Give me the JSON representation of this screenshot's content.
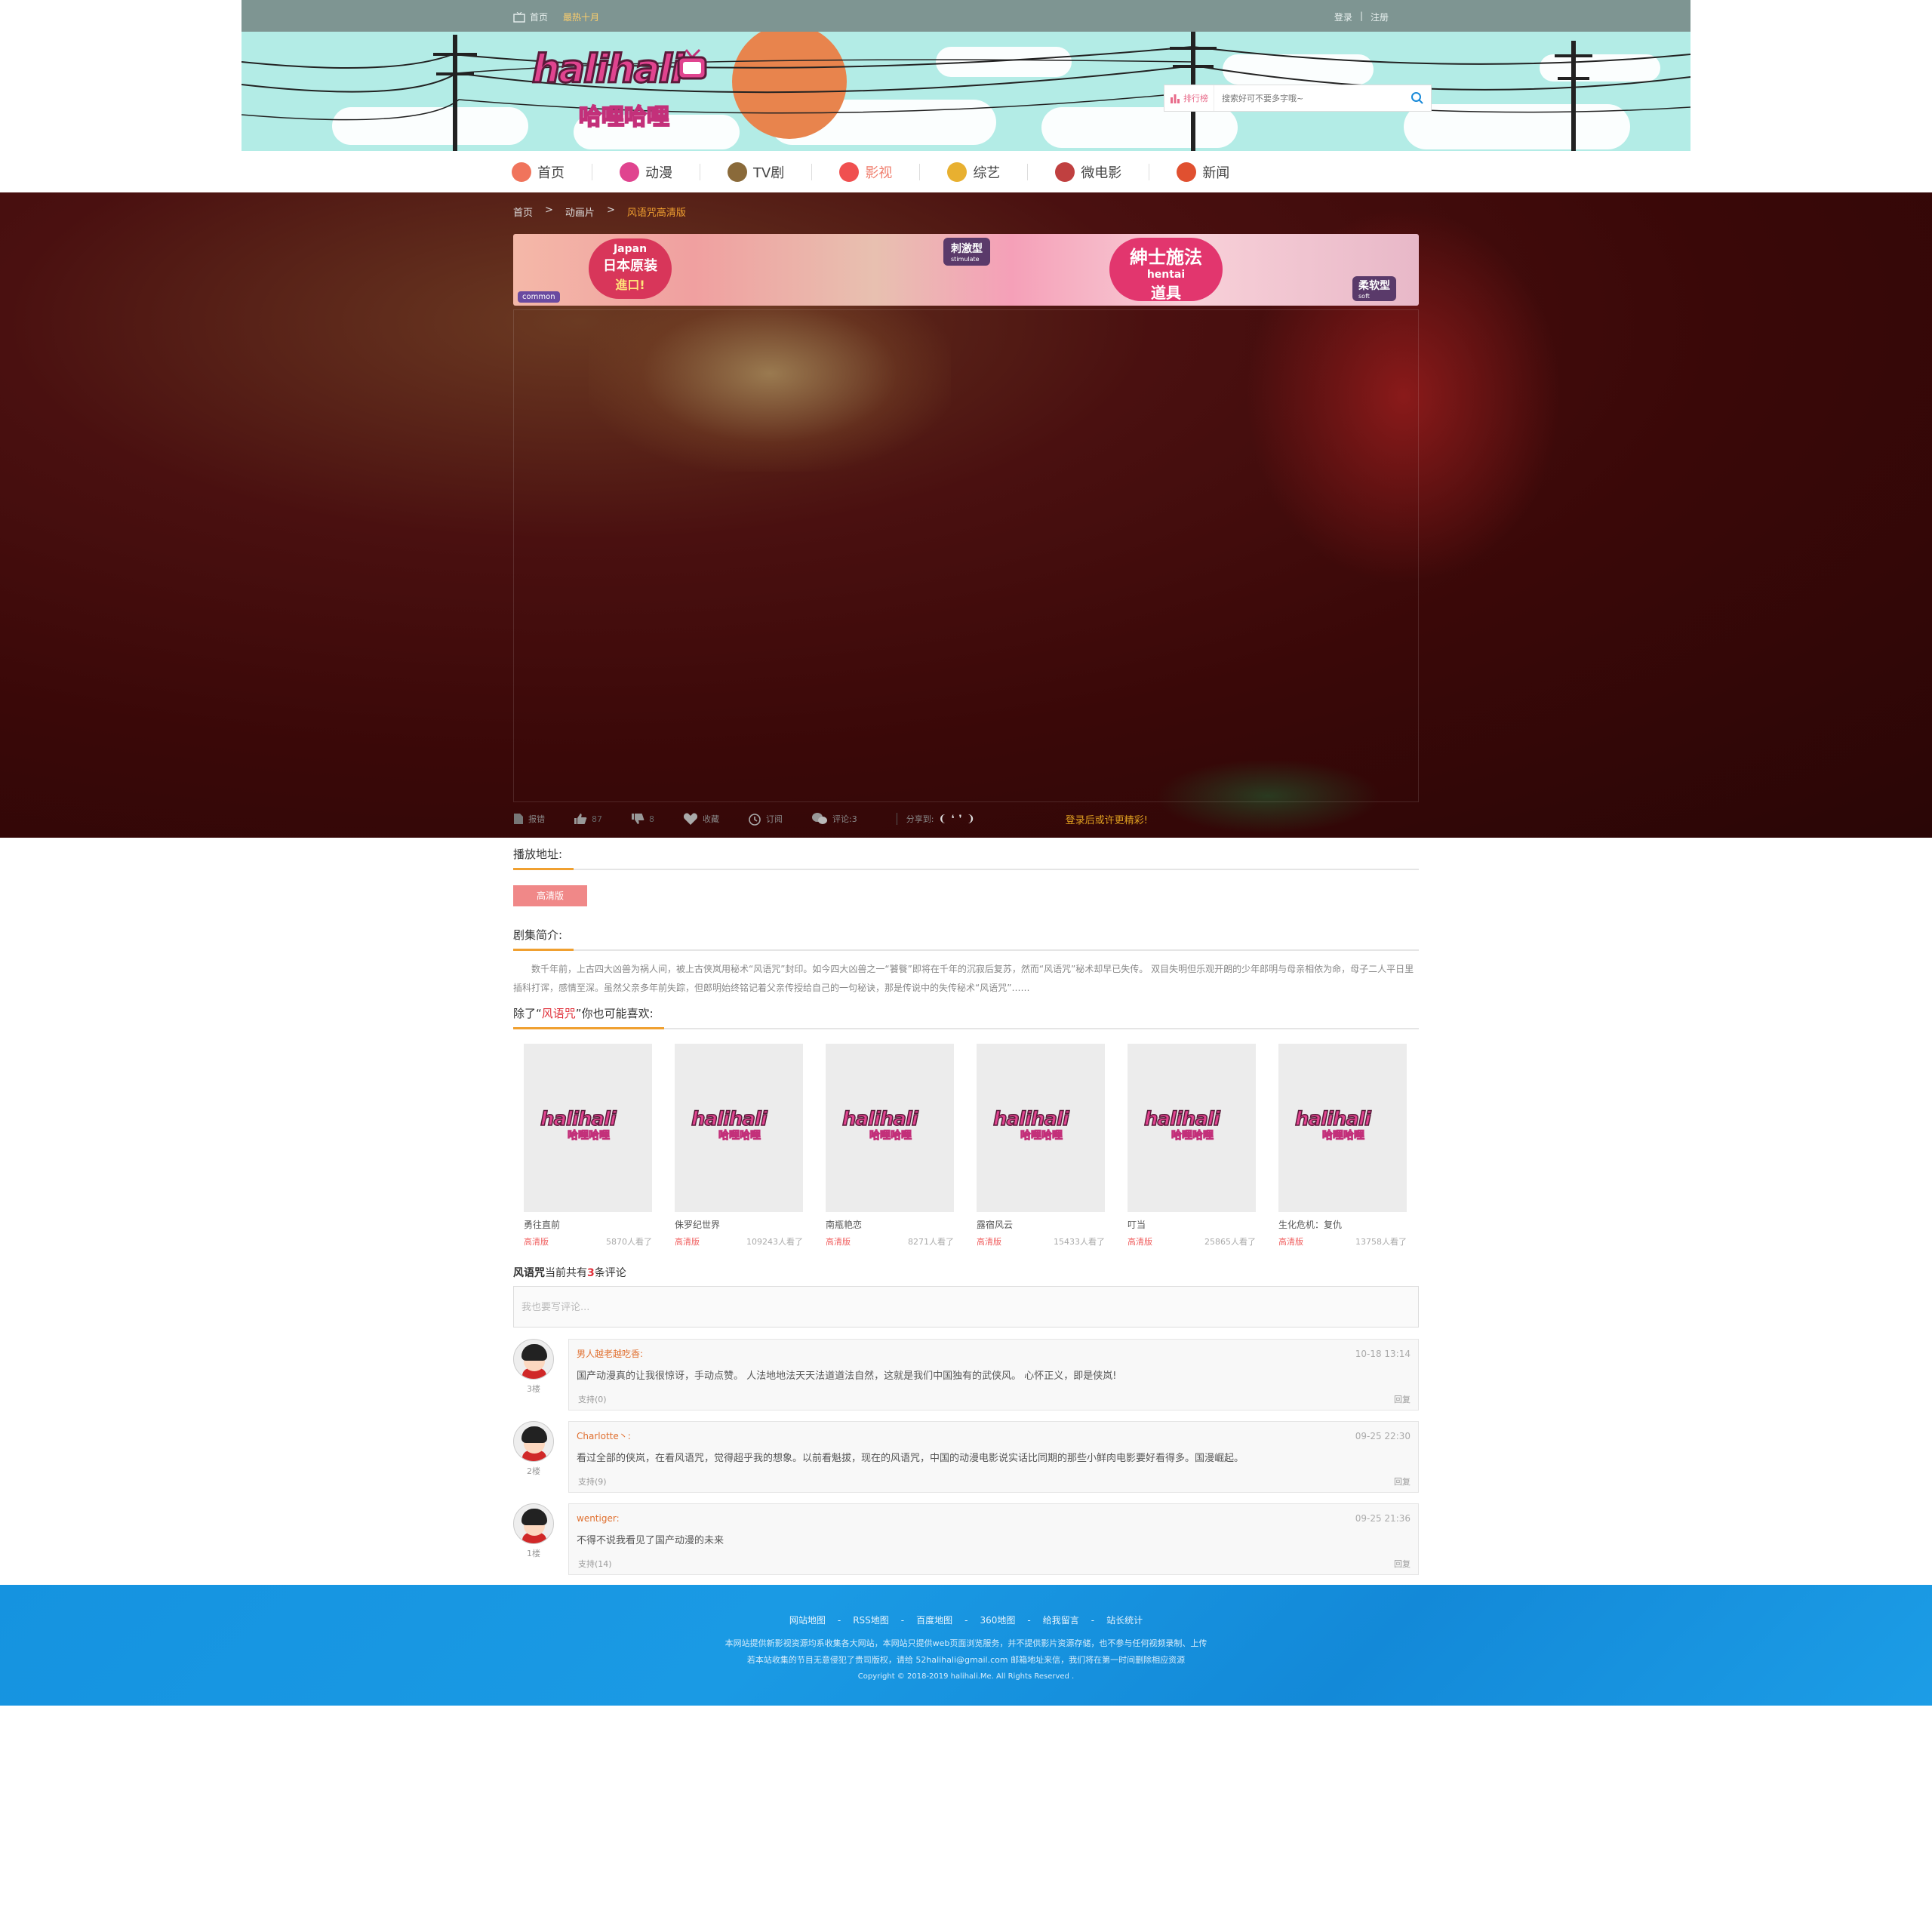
{
  "topbar": {
    "home_label": "首页",
    "hot_label": "最热十月",
    "login": "登录",
    "separator": "|",
    "register": "注册"
  },
  "logo": {
    "latin": "halihali",
    "cn": "哈哩哈哩"
  },
  "search": {
    "rank_label": "排行榜",
    "placeholder": "搜索好可不要多字哦~"
  },
  "nav": [
    {
      "label": "首页",
      "icon": "home-icon",
      "color": "#f0745c"
    },
    {
      "label": "动漫",
      "icon": "anime-icon",
      "color": "#e0448f"
    },
    {
      "label": "TV剧",
      "icon": "tv-icon",
      "color": "#8a6a3a"
    },
    {
      "label": "影视",
      "icon": "film-icon",
      "color": "#f05050",
      "active": true
    },
    {
      "label": "综艺",
      "icon": "microphone-icon",
      "color": "#e8b030"
    },
    {
      "label": "微电影",
      "icon": "butterfly-icon",
      "color": "#c04040"
    },
    {
      "label": "新闻",
      "icon": "newspaper-icon",
      "color": "#e05030"
    }
  ],
  "breadcrumb": {
    "home": "首页",
    "sep1": ">",
    "category": "动画片",
    "sep2": ">",
    "current": "风语咒高清版"
  },
  "ad": {
    "japan": "Japan",
    "japan_cn": "日本原装",
    "import": "進口!",
    "stimulate_cn": "刺激型",
    "stimulate": "stimulate",
    "hentai_cn1": "紳士施法",
    "hentai": "hentai",
    "hentai_cn2": "道具",
    "soft_cn": "柔软型",
    "soft": "soft",
    "common": "common"
  },
  "toolbar": {
    "report": "报错",
    "like_count": "87",
    "dislike_count": "8",
    "favorite": "收藏",
    "remind": "订阅",
    "comment_label": "评论:3",
    "share_label": "分享到:",
    "login_msg": "登录后或许更精彩!"
  },
  "play": {
    "heading": "播放地址:",
    "button": "高清版"
  },
  "intro": {
    "heading": "剧集简介:",
    "text": "数千年前，上古四大凶兽为祸人间，被上古侠岚用秘术“风语咒”封印。如今四大凶兽之一“饕餮”即将在千年的沉寂后复苏，然而“风语咒”秘术却早已失传。 双目失明但乐观开朗的少年郎明与母亲相依为命，母子二人平日里插科打诨，感情至深。虽然父亲多年前失踪，但郎明始终铭记着父亲传授给自己的一句秘诀，那是传说中的失传秘术“风语咒”……"
  },
  "recommend": {
    "prefix": "除了“",
    "title": "风语咒",
    "suffix": "”你也可能喜欢:",
    "items": [
      {
        "title": "勇往直前",
        "quality": "高清版",
        "views": "5870人看了"
      },
      {
        "title": "侏罗纪世界",
        "quality": "高清版",
        "views": "109243人看了"
      },
      {
        "title": "南瓶艳恋",
        "quality": "高清版",
        "views": "8271人看了"
      },
      {
        "title": "露宿风云",
        "quality": "高清版",
        "views": "15433人看了"
      },
      {
        "title": "叮当",
        "quality": "高清版",
        "views": "25865人看了"
      },
      {
        "title": "生化危机：复仇",
        "quality": "高清版",
        "views": "13758人看了"
      }
    ],
    "poster_logo": "halihali",
    "poster_logo_cn": "哈哩哈哩"
  },
  "comments": {
    "title": "风语咒",
    "mid": "当前共有",
    "count": "3",
    "end": "条评论",
    "placeholder": "我也要写评论...",
    "items": [
      {
        "floor": "3楼",
        "user": "男人越老越吃香:",
        "time": "10-18 13:14",
        "text": "国产动漫真的让我很惊讶，手动点赞。 人法地地法天天法道道法自然，这就是我们中国独有的武侠风。 心怀正义，即是侠岚!",
        "support": "支持(0)",
        "reply": "回复"
      },
      {
        "floor": "2楼",
        "user": "Charlotte丶:",
        "time": "09-25 22:30",
        "text": "看过全部的侠岚，在看风语咒，觉得超乎我的想象。以前看魁拔，现在的风语咒，中国的动漫电影说实话比同期的那些小鲜肉电影要好看得多。国漫崛起。",
        "support": "支持(9)",
        "reply": "回复"
      },
      {
        "floor": "1楼",
        "user": "wentiger:",
        "time": "09-25 21:36",
        "text": "不得不说我看见了国产动漫的未来",
        "support": "支持(14)",
        "reply": "回复"
      }
    ]
  },
  "footer": {
    "links": [
      "网站地图",
      "-",
      "RSS地图",
      "-",
      "百度地图",
      "-",
      "360地图",
      "-",
      "给我留言",
      "-",
      "站长统计"
    ],
    "line1": "本网站提供新影视资源均系收集各大网站，本网站只提供web页面浏览服务，并不提供影片资源存储，也不参与任何视频录制、上传",
    "line2": "若本站收集的节目无意侵犯了贵司版权，请给 52halihali@gmail.com 邮箱地址来信，我们将在第一时间删除相应资源",
    "line3": "Copyright © 2018-2019 halihali.Me. All Rights Reserved ."
  }
}
